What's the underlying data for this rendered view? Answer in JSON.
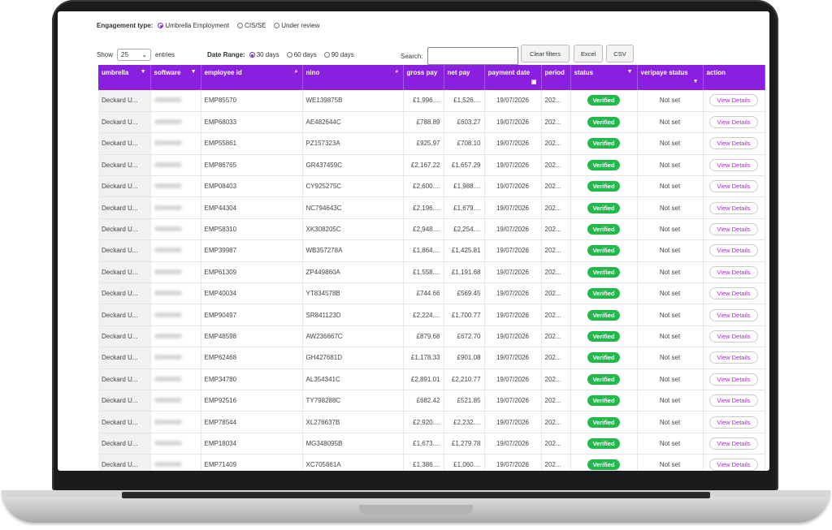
{
  "filters": {
    "engagement_label": "Engagement type:",
    "engagement_options": [
      "Umbrella Employment",
      "CIS/SE",
      "Under review"
    ],
    "show_label": "Show",
    "show_value": "25",
    "entries_label": "entries",
    "date_range_label": "Date Range:",
    "date_options": [
      "30 days",
      "60 days",
      "90 days"
    ],
    "search_label": "Search:",
    "clear_label": "Clear filters",
    "excel_label": "Excel",
    "csv_label": "CSV"
  },
  "columns": [
    "umbrella",
    "software",
    "employee id",
    "nino",
    "gross pay",
    "net pay",
    "payment date",
    "period",
    "status",
    "veripaye status",
    "action"
  ],
  "rows": [
    [
      "Deckard U...",
      "EMP85570",
      "WE139875B",
      "£1,996....",
      "£1,526....",
      "19/07/2026",
      "202...",
      "Verified",
      "Not set",
      "View Details"
    ],
    [
      "Deckard U...",
      "EMP68033",
      "AE482644C",
      "£788.89",
      "£603.27",
      "19/07/2026",
      "202...",
      "Verified",
      "Not set",
      "View Details"
    ],
    [
      "Deckard U...",
      "EMP55861",
      "PZ157323A",
      "£925.97",
      "£708.10",
      "19/07/2026",
      "202...",
      "Verified",
      "Not set",
      "View Details"
    ],
    [
      "Deckard U...",
      "EMP86765",
      "GR437459C",
      "£2,167.22",
      "£1,657.29",
      "19/07/2026",
      "202...",
      "Verified",
      "Not set",
      "View Details"
    ],
    [
      "Deckard U...",
      "EMP08403",
      "CY925275C",
      "£2,600....",
      "£1,988....",
      "19/07/2026",
      "202...",
      "Verified",
      "Not set",
      "View Details"
    ],
    [
      "Deckard U...",
      "EMP44304",
      "NC794643C",
      "£2,196....",
      "£1,679....",
      "19/07/2026",
      "202...",
      "Verified",
      "Not set",
      "View Details"
    ],
    [
      "Deckard U...",
      "EMP58310",
      "XK308205C",
      "£2,948....",
      "£2,254....",
      "19/07/2026",
      "202...",
      "Verified",
      "Not set",
      "View Details"
    ],
    [
      "Deckard U...",
      "EMP39987",
      "WB357278A",
      "£1,864....",
      "£1,425.81",
      "19/07/2026",
      "202...",
      "Verified",
      "Not set",
      "View Details"
    ],
    [
      "Deckard U...",
      "EMP61309",
      "ZP449860A",
      "£1,558....",
      "£1,191.68",
      "19/07/2026",
      "202...",
      "Verified",
      "Not set",
      "View Details"
    ],
    [
      "Deckard U...",
      "EMP40034",
      "YT834578B",
      "£744.66",
      "£569.45",
      "19/07/2026",
      "202...",
      "Verified",
      "Not set",
      "View Details"
    ],
    [
      "Deckard U...",
      "EMP90497",
      "SR841123D",
      "£2,224....",
      "£1,700.77",
      "19/07/2026",
      "202...",
      "Verified",
      "Not set",
      "View Details"
    ],
    [
      "Deckard U...",
      "EMP48598",
      "AW236667C",
      "£879.68",
      "£672.70",
      "19/07/2026",
      "202...",
      "Verified",
      "Not set",
      "View Details"
    ],
    [
      "Deckard U...",
      "EMP62468",
      "GH427681D",
      "£1,178.33",
      "£901.08",
      "19/07/2026",
      "202...",
      "Verified",
      "Not set",
      "View Details"
    ],
    [
      "Deckard U...",
      "EMP34780",
      "AL354341C",
      "£2,891.01",
      "£2,210.77",
      "19/07/2026",
      "202...",
      "Verified",
      "Not set",
      "View Details"
    ],
    [
      "Deckard U...",
      "EMP92516",
      "TY798288C",
      "£682.42",
      "£521.85",
      "19/07/2026",
      "202...",
      "Verified",
      "Not set",
      "View Details"
    ],
    [
      "Deckard U...",
      "EMP78544",
      "XL276637B",
      "£2,920....",
      "£2,232....",
      "19/07/2026",
      "202...",
      "Verified",
      "Not set",
      "View Details"
    ],
    [
      "Deckard U...",
      "EMP18034",
      "MG348095B",
      "£1,673....",
      "£1,279.78",
      "19/07/2026",
      "202...",
      "Verified",
      "Not set",
      "View Details"
    ],
    [
      "Deckard U...",
      "EMP71409",
      "XC705661A",
      "£1,386....",
      "£1,060....",
      "19/07/2026",
      "202...",
      "Verified",
      "Not set",
      "View Details"
    ]
  ]
}
